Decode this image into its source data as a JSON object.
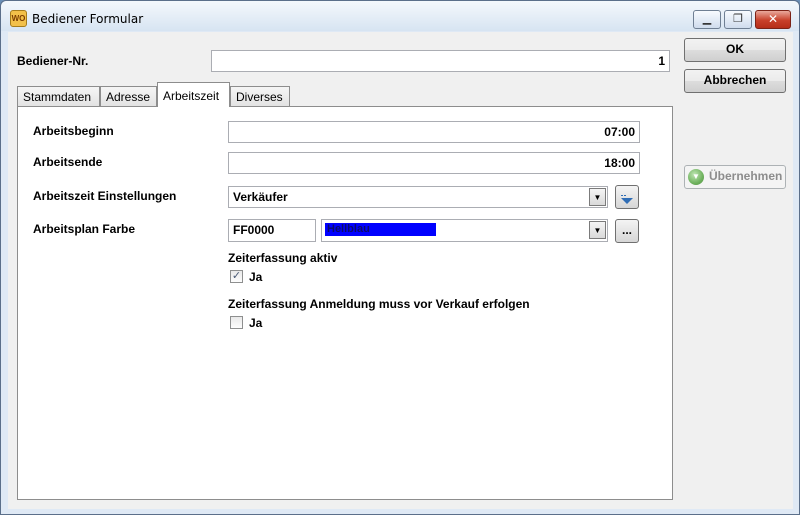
{
  "window": {
    "title": "Bediener Formular",
    "app_icon_text": "WO",
    "min_glyph": "▁",
    "max_glyph": "❐",
    "close_glyph": "✕"
  },
  "header": {
    "bediener_label": "Bediener-Nr.",
    "bediener_value": "1"
  },
  "buttons": {
    "ok": "OK",
    "abbrechen": "Abbrechen",
    "uebernehmen": "Übernehmen"
  },
  "tabs": [
    {
      "label": "Stammdaten"
    },
    {
      "label": "Adresse"
    },
    {
      "label": "Arbeitszeit"
    },
    {
      "label": "Diverses"
    }
  ],
  "arbeitszeit": {
    "beginn_label": "Arbeitsbeginn",
    "beginn_value": "07:00",
    "ende_label": "Arbeitsende",
    "ende_value": "18:00",
    "einstellungen_label": "Arbeitszeit Einstellungen",
    "einstellungen_value": "Verkäufer",
    "farbe_label": "Arbeitsplan Farbe",
    "farbe_code": "FF0000",
    "farbe_name": "Hellblau",
    "farbe_swatch": "#0000ff",
    "ellipsis": "...",
    "zeiterfassung_label": "Zeiterfassung aktiv",
    "zeiterfassung_check": "Ja",
    "zeiterfassung_checked": true,
    "anmeldung_label": "Zeiterfassung Anmeldung muss vor Verkauf erfolgen",
    "anmeldung_check": "Ja",
    "anmeldung_checked": false
  },
  "icons": {
    "combo_arrow": "▼",
    "checkmark": "✓",
    "filter_button": "filter-dropdown-icon",
    "apply_icon": "green-down-arrow-icon"
  }
}
